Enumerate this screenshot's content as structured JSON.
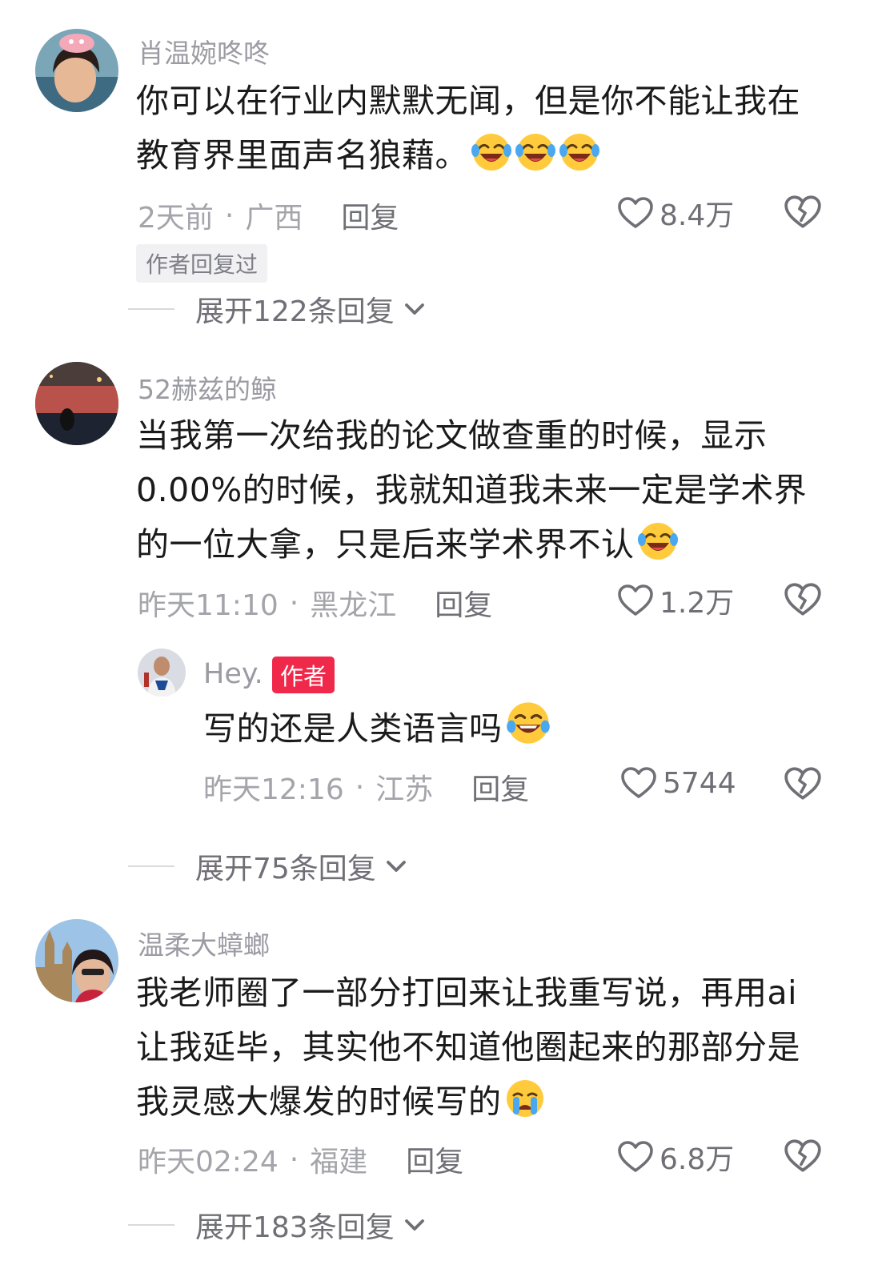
{
  "comments": [
    {
      "username": "肖温婉咚咚",
      "text_lines": [
        "你可以在行业内默默无闻，但是你不能让我在",
        "教育界里面声名狼藉。"
      ],
      "time": "2天前",
      "location": "广西",
      "reply_label": "回复",
      "likes": "8.4万",
      "author_replied_badge": "作者回复过",
      "expand_label": "展开122条回复",
      "emoji": "laughing-tears-emoji"
    },
    {
      "username": "52赫兹的鲸",
      "text_lines": [
        "当我第一次给我的论文做查重的时候，显示",
        "0.00%的时候，我就知道我未来一定是学术界",
        "的一位大拿，只是后来学术界不认"
      ],
      "time": "昨天11:10",
      "location": "黑龙江",
      "reply_label": "回复",
      "likes": "1.2万",
      "emoji": "laughing-tears-emoji",
      "reply": {
        "username": "Hey.",
        "author_tag": "作者",
        "text": "写的还是人类语言吗",
        "time": "昨天12:16",
        "location": "江苏",
        "reply_label": "回复",
        "likes": "5744",
        "emoji": "joy-emoji"
      },
      "expand_label": "展开75条回复"
    },
    {
      "username": "温柔大蟑螂",
      "text_lines": [
        "我老师圈了一部分打回来让我重写说，再用ai",
        "让我延毕，其实他不知道他圈起来的那部分是",
        "我灵感大爆发的时候写的"
      ],
      "time": "昨天02:24",
      "location": "福建",
      "reply_label": "回复",
      "likes": "6.8万",
      "emoji": "crying-emoji",
      "expand_label": "展开183条回复"
    }
  ],
  "colors": {
    "accent_red": "#f0284a",
    "text": "#1a1a1a",
    "muted": "#a4a4ab"
  }
}
